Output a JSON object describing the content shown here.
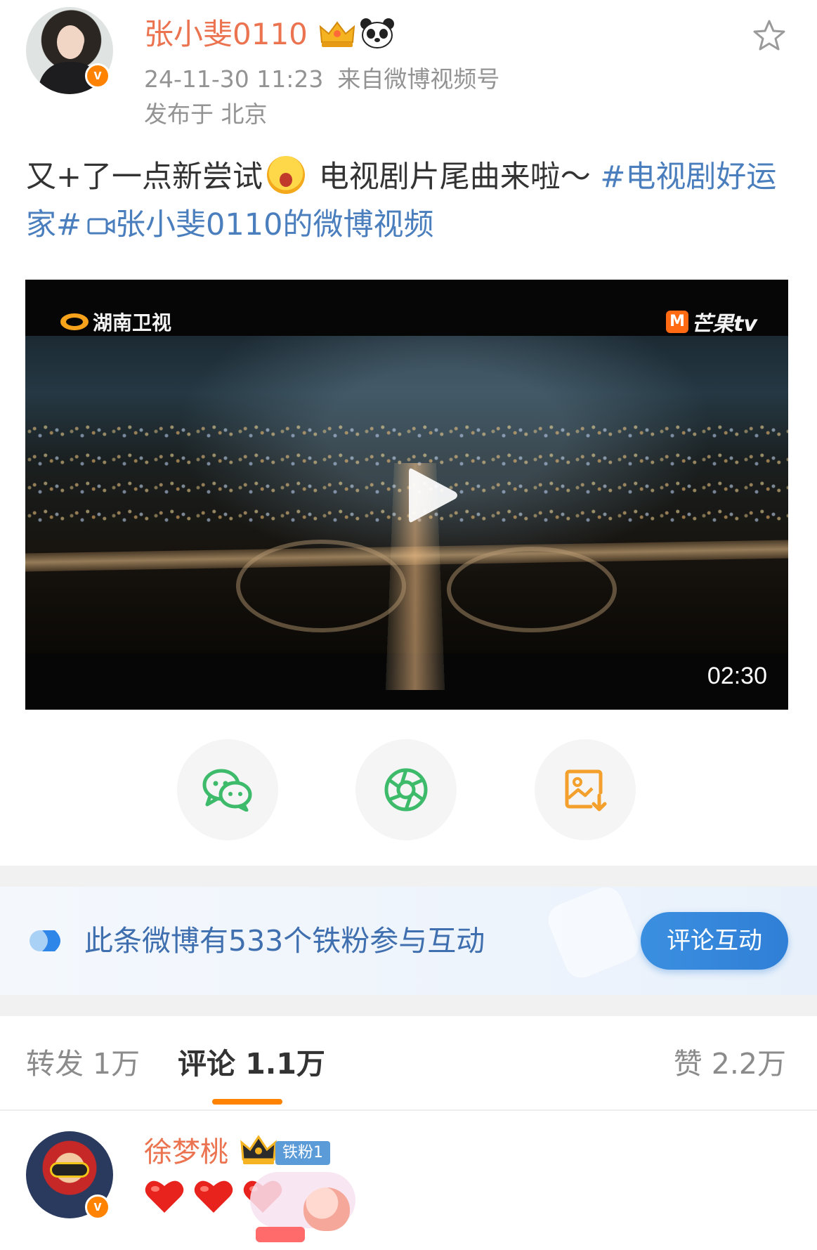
{
  "post": {
    "username": "张小斐0110",
    "datetime": "24-11-30 11:23",
    "source": "来自微博视频号",
    "location": "发布于 北京",
    "text_part1": "又+了一点新尝试",
    "text_part2": " 电视剧片尾曲来啦～ ",
    "hashtag": "#电视剧好运家#",
    "video_link": "张小斐0110的微博视频",
    "emoji_name": "surprised-face-emoji",
    "badges": [
      "crown-level-icon",
      "panda-icon"
    ],
    "verified_badge": "v"
  },
  "video": {
    "logo_left": "湖南卫视",
    "logo_right": "芒果tv",
    "logo_right_mark": "M",
    "duration": "02:30"
  },
  "share": {
    "items": [
      {
        "name": "wechat-share-icon",
        "color": "#3dbb6b"
      },
      {
        "name": "moments-share-icon",
        "color": "#3dbb6b"
      },
      {
        "name": "save-image-icon",
        "color": "#f3a12c"
      }
    ]
  },
  "fan_banner": {
    "text": "此条微博有533个铁粉参与互动",
    "button": "评论互动",
    "icon": "play-toggle-icon"
  },
  "tabs": {
    "repost": "转发 1万",
    "comment": "评论 1.1万",
    "like": "赞 2.2万",
    "active": "comment"
  },
  "comment": {
    "username": "徐梦桃",
    "fan_badge": "铁粉1",
    "verified_badge": "v",
    "emojis": [
      "heart-emoji",
      "heart-emoji",
      "heart-emoji"
    ],
    "sticker": "peach-sticker"
  },
  "colors": {
    "username": "#eb7350",
    "link": "#4a7ebd",
    "accent": "#ff8200",
    "fan_button": "#2f7fd6"
  }
}
